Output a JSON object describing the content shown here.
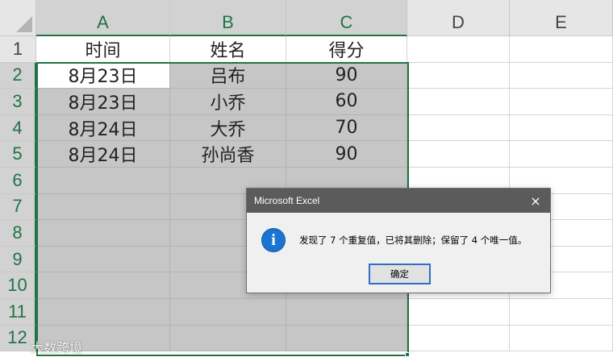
{
  "sheet": {
    "columns": [
      "A",
      "B",
      "C",
      "D",
      "E"
    ],
    "rows": [
      "1",
      "2",
      "3",
      "4",
      "5",
      "6",
      "7",
      "8",
      "9",
      "10",
      "11",
      "12"
    ],
    "cells": [
      [
        "时间",
        "姓名",
        "得分",
        "",
        ""
      ],
      [
        "8月23日",
        "吕布",
        "90",
        "",
        ""
      ],
      [
        "8月23日",
        "小乔",
        "60",
        "",
        ""
      ],
      [
        "8月24日",
        "大乔",
        "70",
        "",
        ""
      ],
      [
        "8月24日",
        "孙尚香",
        "90",
        "",
        ""
      ],
      [
        "",
        "",
        "",
        "",
        ""
      ],
      [
        "",
        "",
        "",
        "",
        ""
      ],
      [
        "",
        "",
        "",
        "",
        ""
      ],
      [
        "",
        "",
        "",
        "",
        ""
      ],
      [
        "",
        "",
        "",
        "",
        ""
      ],
      [
        "",
        "",
        "",
        "",
        ""
      ],
      [
        "",
        "",
        "",
        "",
        ""
      ]
    ],
    "accent_color": "#217346"
  },
  "dialog": {
    "title": "Microsoft Excel",
    "close_icon": "×",
    "info_icon": "i",
    "message": "发现了 7 个重复值，已将其删除；保留了 4 个唯一值。",
    "ok_label": "确定"
  },
  "watermark": "大数跨境"
}
